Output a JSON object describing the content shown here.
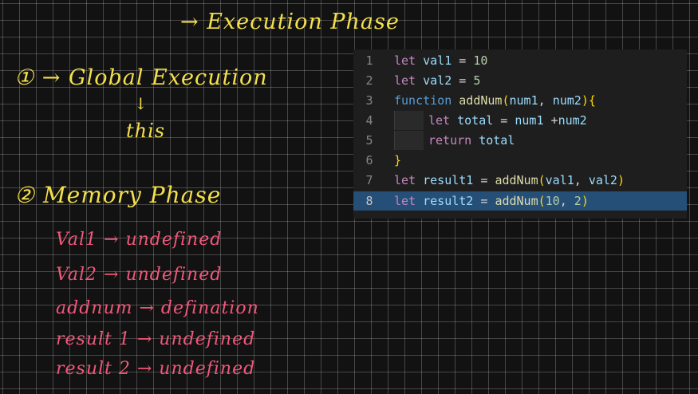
{
  "whiteboard": {
    "title": "→ Execution Phase",
    "step1": "① → Global Execution",
    "down_arrow": "↓",
    "this_label": "this",
    "step2": "② Memory Phase",
    "memory_entries": [
      "Val1 → undefined",
      "Val2 → undefined",
      "addnum → defination",
      "result 1 → undefined",
      "result 2 → undefined"
    ]
  },
  "editor": {
    "lines": [
      {
        "number": "1",
        "text": "let val1 = 10"
      },
      {
        "number": "2",
        "text": "let val2 = 5"
      },
      {
        "number": "3",
        "text": "function addNum(num1, num2){"
      },
      {
        "number": "4",
        "text": "let total = num1 +num2"
      },
      {
        "number": "5",
        "text": "return total"
      },
      {
        "number": "6",
        "text": "}"
      },
      {
        "number": "7",
        "text": "let result1 = addNum(val1, val2)"
      },
      {
        "number": "8",
        "text": "let result2 = addNum(10, 2)"
      }
    ],
    "selected_line": "8"
  },
  "colors": {
    "board_background": "#121212",
    "yellow_ink": "#f4e04a",
    "pink_ink": "#f0577a",
    "editor_background": "#1e1e1e",
    "selection": "#264f78"
  }
}
